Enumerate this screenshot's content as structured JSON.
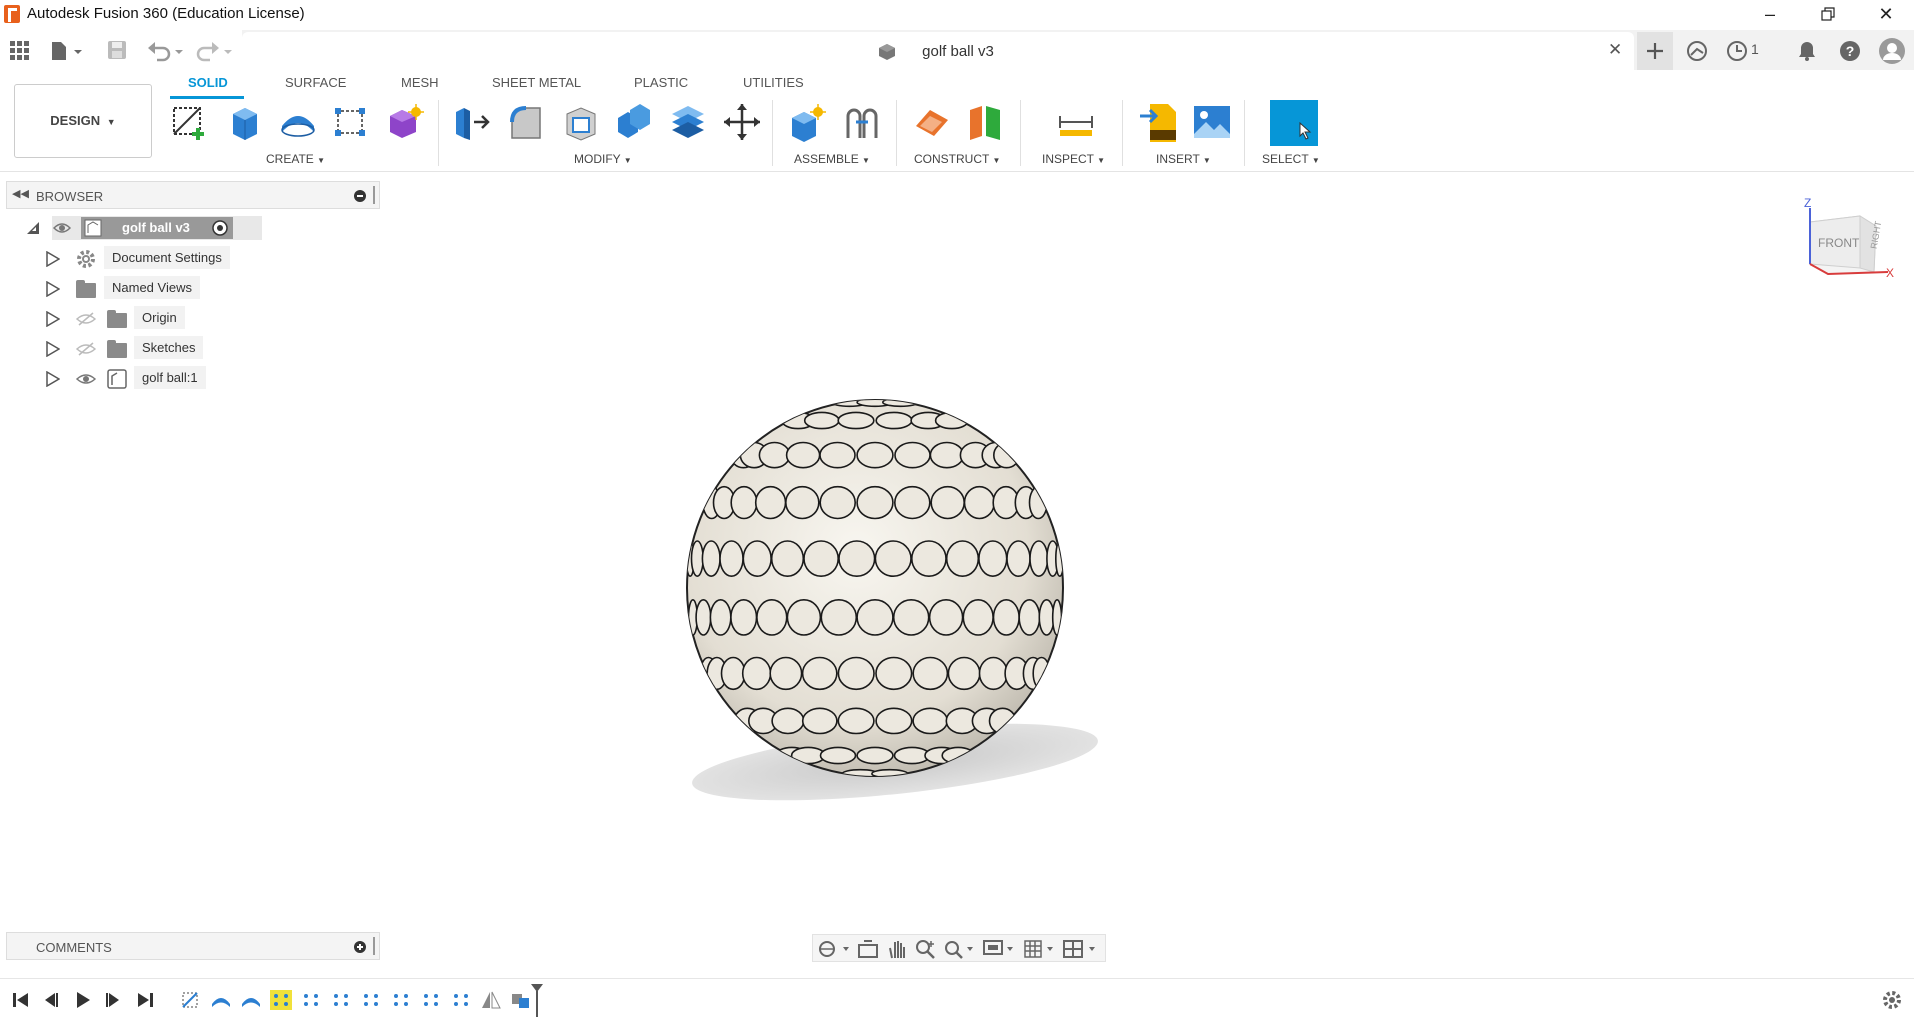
{
  "window": {
    "title": "Autodesk Fusion 360 (Education License)",
    "minimize_icon": "minimize-icon",
    "restore_icon": "restore-icon",
    "close_icon": "close-icon"
  },
  "document_tab": {
    "title": "golf ball v3",
    "close_symbol": "✕"
  },
  "top_right": {
    "job_count": "1"
  },
  "ribbon": {
    "workspace": "DESIGN",
    "tabs": [
      "SOLID",
      "SURFACE",
      "MESH",
      "SHEET METAL",
      "PLASTIC",
      "UTILITIES"
    ],
    "active_tab": "SOLID",
    "groups": [
      "CREATE",
      "MODIFY",
      "ASSEMBLE",
      "CONSTRUCT",
      "INSPECT",
      "INSERT",
      "SELECT"
    ],
    "accent": "#0696d7"
  },
  "browser": {
    "title": "BROWSER",
    "root": "golf ball v3",
    "items": [
      "Document Settings",
      "Named Views",
      "Origin",
      "Sketches",
      "golf ball:1"
    ]
  },
  "viewcube": {
    "face": "FRONT",
    "side": "RIGHT",
    "axis_z": "Z",
    "axis_x": "X"
  },
  "comments": {
    "title": "COMMENTS"
  }
}
